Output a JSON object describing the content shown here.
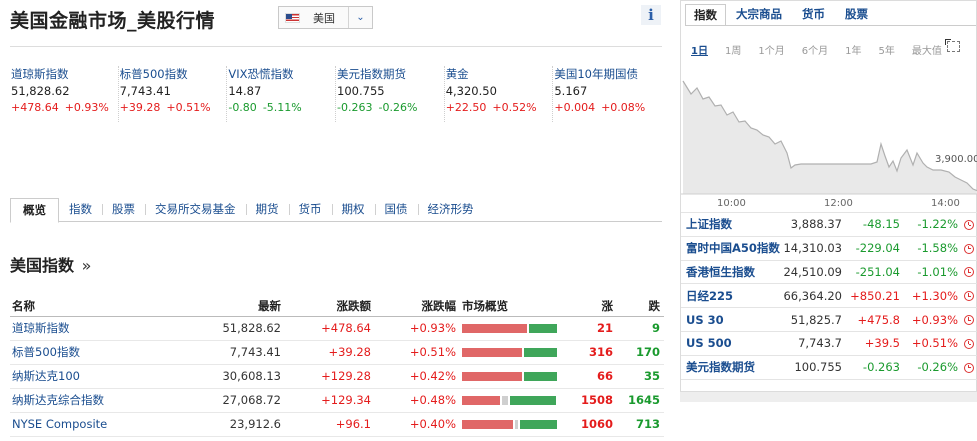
{
  "page": {
    "title": "美国金融市场_美股行情",
    "region_selector": "美国"
  },
  "tiles": [
    {
      "name": "道琼斯指数",
      "value": "51,828.62",
      "change": "+478.64",
      "pct": "+0.93%",
      "dir": "up"
    },
    {
      "name": "标普500指数",
      "value": "7,743.41",
      "change": "+39.28",
      "pct": "+0.51%",
      "dir": "up"
    },
    {
      "name": "VIX恐慌指数",
      "value": "14.87",
      "change": "-0.80",
      "pct": "-5.11%",
      "dir": "down"
    },
    {
      "name": "美元指数期货",
      "value": "100.755",
      "change": "-0.263",
      "pct": "-0.26%",
      "dir": "down"
    },
    {
      "name": "黄金",
      "value": "4,320.50",
      "change": "+22.50",
      "pct": "+0.52%",
      "dir": "up"
    },
    {
      "name": "美国10年期国债",
      "value": "5.167",
      "change": "+0.004",
      "pct": "+0.08%",
      "dir": "up"
    }
  ],
  "tabs": [
    "概览",
    "指数",
    "股票",
    "交易所交易基金",
    "期货",
    "货币",
    "期权",
    "国债",
    "经济形势"
  ],
  "section": {
    "title": "美国指数",
    "more": "»"
  },
  "table": {
    "headers": {
      "name": "名称",
      "last": "最新",
      "change": "涨跌额",
      "pct": "涨跌幅",
      "overview": "市场概览",
      "adv": "涨",
      "dec": "跌"
    },
    "rows": [
      {
        "name": "道琼斯指数",
        "last": "51,828.62",
        "change": "+478.64",
        "pct": "+0.93%",
        "adv": "21",
        "dec": "9",
        "up_share": 0.7,
        "flat_share": 0.0
      },
      {
        "name": "标普500指数",
        "last": "7,743.41",
        "change": "+39.28",
        "pct": "+0.51%",
        "adv": "316",
        "dec": "170",
        "up_share": 0.65,
        "flat_share": 0.0
      },
      {
        "name": "纳斯达克100",
        "last": "30,608.13",
        "change": "+129.28",
        "pct": "+0.42%",
        "adv": "66",
        "dec": "35",
        "up_share": 0.65,
        "flat_share": 0.0
      },
      {
        "name": "纳斯达克综合指数",
        "last": "27,068.72",
        "change": "+129.34",
        "pct": "+0.48%",
        "adv": "1508",
        "dec": "1645",
        "up_share": 0.42,
        "flat_share": 0.07
      },
      {
        "name": "NYSE Composite",
        "last": "23,912.6",
        "change": "+96.1",
        "pct": "+0.40%",
        "adv": "1060",
        "dec": "713",
        "up_share": 0.56,
        "flat_share": 0.03
      }
    ]
  },
  "right_panel": {
    "tabs": [
      "指数",
      "大宗商品",
      "货币",
      "股票"
    ],
    "ranges": [
      "1日",
      "1周",
      "1个月",
      "6个月",
      "1年",
      "5年",
      "最大值"
    ],
    "chart": {
      "x_labels": [
        "10:00",
        "12:00",
        "14:00"
      ],
      "y_label": "3,900.00",
      "line_color": "#b0b0b0",
      "fill_color": "#e9e9e9"
    },
    "quotes": [
      {
        "name": "上证指数",
        "value": "3,888.37",
        "change": "-48.15",
        "pct": "-1.22%",
        "dir": "down"
      },
      {
        "name": "富时中国A50指数",
        "value": "14,310.03",
        "change": "-229.04",
        "pct": "-1.58%",
        "dir": "down"
      },
      {
        "name": "香港恒生指数",
        "value": "24,510.09",
        "change": "-251.04",
        "pct": "-1.01%",
        "dir": "down"
      },
      {
        "name": "日经225",
        "value": "66,364.20",
        "change": "+850.21",
        "pct": "+1.30%",
        "dir": "up"
      },
      {
        "name": "US 30",
        "value": "51,825.7",
        "change": "+475.8",
        "pct": "+0.93%",
        "dir": "up"
      },
      {
        "name": "US 500",
        "value": "7,743.7",
        "change": "+39.5",
        "pct": "+0.51%",
        "dir": "up"
      },
      {
        "name": "美元指数期货",
        "value": "100.755",
        "change": "-0.263",
        "pct": "-0.26%",
        "dir": "down"
      }
    ]
  }
}
